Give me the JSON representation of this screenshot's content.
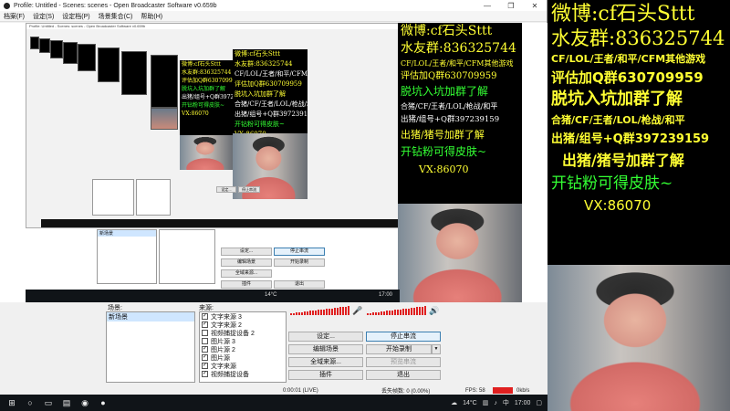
{
  "window": {
    "title": "Profile: Untitled - Scenes: scenes - Open Broadcaster Software v0.659b",
    "controls": [
      "—",
      "❐",
      "✕"
    ]
  },
  "menu": [
    "档案(F)",
    "设定(S)",
    "设定档(P)",
    "场景集合(C)",
    "帮助(H)"
  ],
  "overlay": {
    "weibo": "微博:cf石头Sttt",
    "qq_group": "水友群:836325744",
    "games": "CF/LOL/王者/和平/CFM其他游戏",
    "rate": "评估加Q群630709959",
    "join": "脱坑入坑加群了解",
    "team": "合猪/CF/王者/LOL/枪战/和平",
    "pig": "出猪/组号+Q群397239159",
    "pig2": "出猪/猪号加群了解",
    "skin": "开钻粉可得皮肤~",
    "vx": "VX:86070"
  },
  "docks": {
    "scenes_title": "场景:",
    "sources_title": "来源:",
    "scenes": [
      "新场景"
    ],
    "sources": [
      {
        "label": "文字来源 3",
        "checked": true
      },
      {
        "label": "文字来源 2",
        "checked": true
      },
      {
        "label": "视频捕捉设备 2",
        "checked": false
      },
      {
        "label": "图片源 3",
        "checked": false
      },
      {
        "label": "图片源 2",
        "checked": true
      },
      {
        "label": "图片源",
        "checked": true
      },
      {
        "label": "文字来源",
        "checked": true
      },
      {
        "label": "视频捕捉设备",
        "checked": true
      }
    ]
  },
  "buttons": {
    "settings": "设定...",
    "stop_stream": "停止串流",
    "edit_scene": "编辑场景",
    "start_record": "开始录制",
    "global_sources": "全域来源...",
    "preview_stream": "预览串流",
    "plugins": "插件",
    "exit": "退出"
  },
  "status": {
    "time": "0:00:01 (LIVE)",
    "dropped": "丢失帧数: 0 (0.00%)",
    "fps": "FPS: 58",
    "bitrate": "0kb/s"
  },
  "taskbar": {
    "weather": "14°C",
    "clock": "17:00",
    "ime": "中"
  },
  "colors": {
    "yellow": "#ffff33",
    "green": "#33ff33",
    "meter": "#e02020",
    "taskbar": "#101418"
  }
}
